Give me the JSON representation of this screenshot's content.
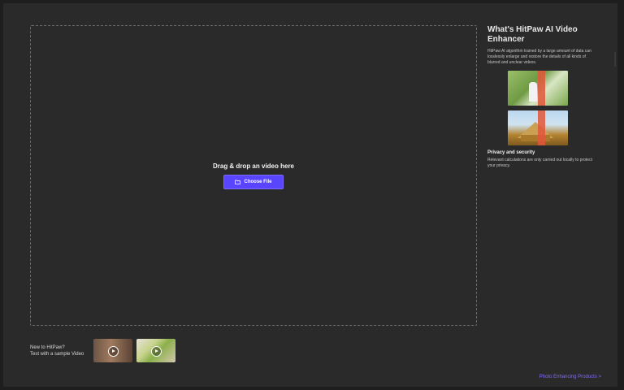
{
  "dropzone": {
    "title": "Drag & drop an video here",
    "button_label": "Choose File",
    "button_icon": "folder-icon"
  },
  "sidebar": {
    "title": "What's HitPaw AI Video Enhancer",
    "description": "HitPaw AI algorithm trained by a large amount of data can losslessly enlarge and restore the details of all kinds of blurred and unclear videos.",
    "privacy_title": "Privacy and security",
    "privacy_description": "Relevant calculations are only carried out locally to protect your privacy."
  },
  "sample": {
    "line1": "New to HitPaw?",
    "line2": "Test with a sample Video"
  },
  "footer": {
    "link_label": "Photo Enhancing Products >"
  },
  "colors": {
    "accent": "#5a45ff",
    "link": "#7f6dff",
    "background": "#2a2a2a"
  }
}
